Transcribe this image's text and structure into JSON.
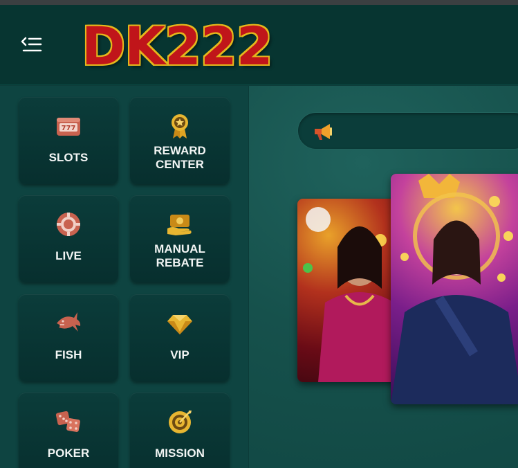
{
  "header": {
    "logo_text": "DK222",
    "menu_icon": "menu-collapse-icon"
  },
  "sidebar": {
    "tiles": [
      {
        "label": "SLOTS",
        "icon": "slot-machine-icon"
      },
      {
        "label": "REWARD\nCENTER",
        "icon": "award-medal-icon"
      },
      {
        "label": "LIVE",
        "icon": "casino-chip-icon"
      },
      {
        "label": "MANUAL\nREBATE",
        "icon": "money-hand-icon"
      },
      {
        "label": "FISH",
        "icon": "shark-icon"
      },
      {
        "label": "VIP",
        "icon": "diamond-icon"
      },
      {
        "label": "POKER",
        "icon": "dice-icon"
      },
      {
        "label": "MISSION",
        "icon": "target-icon"
      }
    ]
  },
  "announcement": {
    "icon": "megaphone-icon",
    "text": ""
  },
  "banners": [
    {
      "name": "promo-banner-1"
    },
    {
      "name": "promo-banner-2"
    }
  ],
  "colors": {
    "header_bg": "#073531",
    "tile_bg": "#0b3c3a",
    "accent_gold": "#e5b81c",
    "logo_red": "#c0151a",
    "icon_salmon": "#d9735e"
  }
}
